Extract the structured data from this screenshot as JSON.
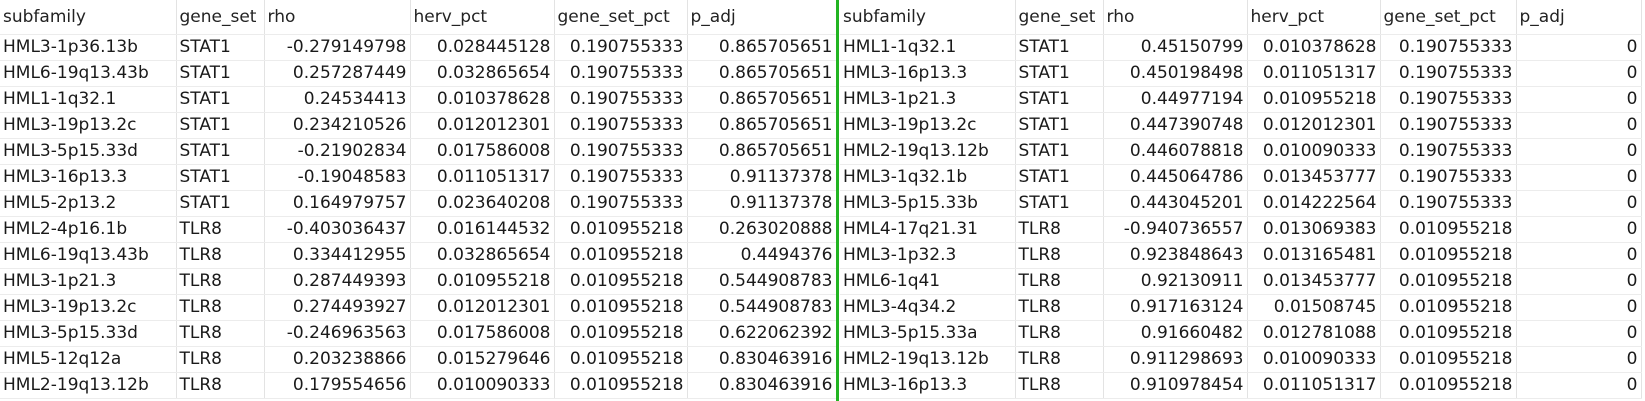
{
  "left": {
    "headers": [
      "subfamily",
      "gene_set",
      "rho",
      "herv_pct",
      "gene_set_pct",
      "p_adj"
    ],
    "rows": [
      [
        "HML3-1p36.13b",
        "STAT1",
        "-0.279149798",
        "0.028445128",
        "0.190755333",
        "0.865705651"
      ],
      [
        "HML6-19q13.43b",
        "STAT1",
        "0.257287449",
        "0.032865654",
        "0.190755333",
        "0.865705651"
      ],
      [
        "HML1-1q32.1",
        "STAT1",
        "0.24534413",
        "0.010378628",
        "0.190755333",
        "0.865705651"
      ],
      [
        "HML3-19p13.2c",
        "STAT1",
        "0.234210526",
        "0.012012301",
        "0.190755333",
        "0.865705651"
      ],
      [
        "HML3-5p15.33d",
        "STAT1",
        "-0.21902834",
        "0.017586008",
        "0.190755333",
        "0.865705651"
      ],
      [
        "HML3-16p13.3",
        "STAT1",
        "-0.19048583",
        "0.011051317",
        "0.190755333",
        "0.91137378"
      ],
      [
        "HML5-2p13.2",
        "STAT1",
        "0.164979757",
        "0.023640208",
        "0.190755333",
        "0.91137378"
      ],
      [
        "HML2-4p16.1b",
        "TLR8",
        "-0.403036437",
        "0.016144532",
        "0.010955218",
        "0.263020888"
      ],
      [
        "HML6-19q13.43b",
        "TLR8",
        "0.334412955",
        "0.032865654",
        "0.010955218",
        "0.4494376"
      ],
      [
        "HML3-1p21.3",
        "TLR8",
        "0.287449393",
        "0.010955218",
        "0.010955218",
        "0.544908783"
      ],
      [
        "HML3-19p13.2c",
        "TLR8",
        "0.274493927",
        "0.012012301",
        "0.010955218",
        "0.544908783"
      ],
      [
        "HML3-5p15.33d",
        "TLR8",
        "-0.246963563",
        "0.017586008",
        "0.010955218",
        "0.622062392"
      ],
      [
        "HML5-12q12a",
        "TLR8",
        "0.203238866",
        "0.015279646",
        "0.010955218",
        "0.830463916"
      ],
      [
        "HML2-19q13.12b",
        "TLR8",
        "0.179554656",
        "0.010090333",
        "0.010955218",
        "0.830463916"
      ]
    ]
  },
  "right": {
    "headers": [
      "subfamily",
      "gene_set",
      "rho",
      "herv_pct",
      "gene_set_pct",
      "p_adj"
    ],
    "rows": [
      [
        "HML1-1q32.1",
        "STAT1",
        "0.45150799",
        "0.010378628",
        "0.190755333",
        "0"
      ],
      [
        "HML3-16p13.3",
        "STAT1",
        "0.450198498",
        "0.011051317",
        "0.190755333",
        "0"
      ],
      [
        "HML3-1p21.3",
        "STAT1",
        "0.44977194",
        "0.010955218",
        "0.190755333",
        "0"
      ],
      [
        "HML3-19p13.2c",
        "STAT1",
        "0.447390748",
        "0.012012301",
        "0.190755333",
        "0"
      ],
      [
        "HML2-19q13.12b",
        "STAT1",
        "0.446078818",
        "0.010090333",
        "0.190755333",
        "0"
      ],
      [
        "HML3-1q32.1b",
        "STAT1",
        "0.445064786",
        "0.013453777",
        "0.190755333",
        "0"
      ],
      [
        "HML3-5p15.33b",
        "STAT1",
        "0.443045201",
        "0.014222564",
        "0.190755333",
        "0"
      ],
      [
        "HML4-17q21.31",
        "TLR8",
        "-0.940736557",
        "0.013069383",
        "0.010955218",
        "0"
      ],
      [
        "HML3-1p32.3",
        "TLR8",
        "0.923848643",
        "0.013165481",
        "0.010955218",
        "0"
      ],
      [
        "HML6-1q41",
        "TLR8",
        "0.92130911",
        "0.013453777",
        "0.010955218",
        "0"
      ],
      [
        "HML3-4q34.2",
        "TLR8",
        "0.917163124",
        "0.01508745",
        "0.010955218",
        "0"
      ],
      [
        "HML3-5p15.33a",
        "TLR8",
        "0.91660482",
        "0.012781088",
        "0.010955218",
        "0"
      ],
      [
        "HML2-19q13.12b",
        "TLR8",
        "0.911298693",
        "0.010090333",
        "0.010955218",
        "0"
      ],
      [
        "HML3-16p13.3",
        "TLR8",
        "0.910978454",
        "0.011051317",
        "0.010955218",
        "0"
      ]
    ]
  },
  "colors": {
    "divider": "#22b422",
    "grid": "#e3e3e3"
  }
}
